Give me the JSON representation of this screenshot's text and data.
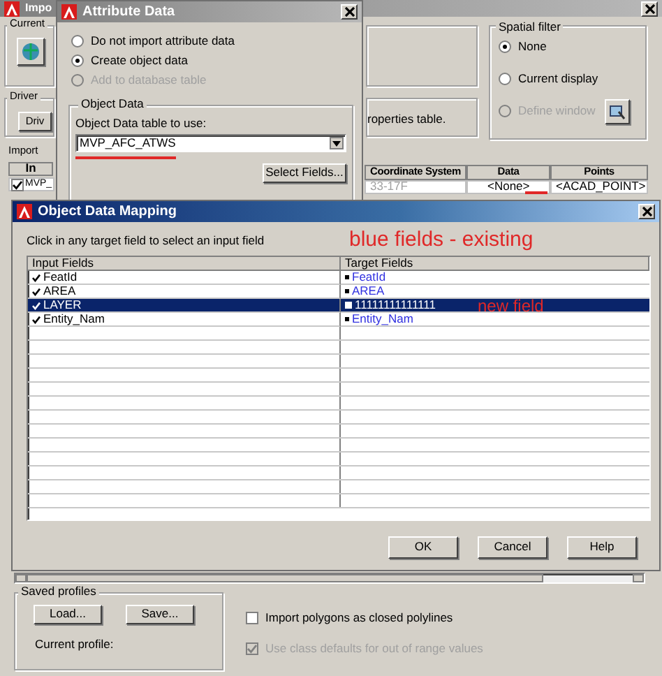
{
  "import_window": {
    "title": "Impo",
    "current_group": {
      "label": "Current"
    },
    "driver_group": {
      "label": "Driver",
      "button": "Driv"
    },
    "import_label": "Import",
    "left_table": {
      "header": "In",
      "row": {
        "text": "MVP_",
        "checked": true
      }
    },
    "info_text": "roperties table.",
    "spatial_filter": {
      "label": "Spatial filter",
      "options": [
        {
          "label": "None",
          "selected": true,
          "disabled": false
        },
        {
          "label": "Current display",
          "selected": false,
          "disabled": false
        },
        {
          "label": "Define window",
          "selected": false,
          "disabled": true
        }
      ]
    },
    "table": {
      "columns": [
        "Coordinate System",
        "Data",
        "Points"
      ],
      "row": [
        "33-17F",
        "<None>",
        "<ACAD_POINT>"
      ]
    },
    "saved_profiles": {
      "label": "Saved profiles",
      "buttons": [
        "Load...",
        "Save..."
      ],
      "current_profile": "Current profile:"
    },
    "options": [
      {
        "label": "Import polygons as closed polylines",
        "checked": false,
        "disabled": false
      },
      {
        "label": "Use class defaults for out of range values",
        "checked": true,
        "disabled": true
      }
    ]
  },
  "attribute_window": {
    "title": "Attribute Data",
    "options": [
      {
        "label": "Do not import attribute data",
        "selected": false,
        "disabled": false
      },
      {
        "label": "Create object data",
        "selected": true,
        "disabled": false
      },
      {
        "label": "Add to database table",
        "selected": false,
        "disabled": true
      }
    ],
    "group_label": "Object Data",
    "table_label": "Object Data table to use:",
    "table_value": "MVP_AFC_ATWS",
    "select_fields": "Select Fields..."
  },
  "mapping_window": {
    "title": "Object Data Mapping",
    "instruction": "Click in any target field to select an input field",
    "columns": [
      "Input Fields",
      "Target Fields"
    ],
    "rows": [
      {
        "input": "FeatId",
        "target": "FeatId",
        "checked": true,
        "selected": false,
        "existing": true
      },
      {
        "input": "AREA",
        "target": "AREA",
        "checked": true,
        "selected": false,
        "existing": true
      },
      {
        "input": "LAYER",
        "target": "11111111111111",
        "checked": true,
        "selected": true,
        "existing": false
      },
      {
        "input": "Entity_Nam",
        "target": "Entity_Nam",
        "checked": true,
        "selected": false,
        "existing": true
      }
    ],
    "buttons": [
      "OK",
      "Cancel",
      "Help"
    ]
  },
  "annotations": [
    {
      "text": "blue fields - existing"
    },
    {
      "text": "new field"
    }
  ]
}
